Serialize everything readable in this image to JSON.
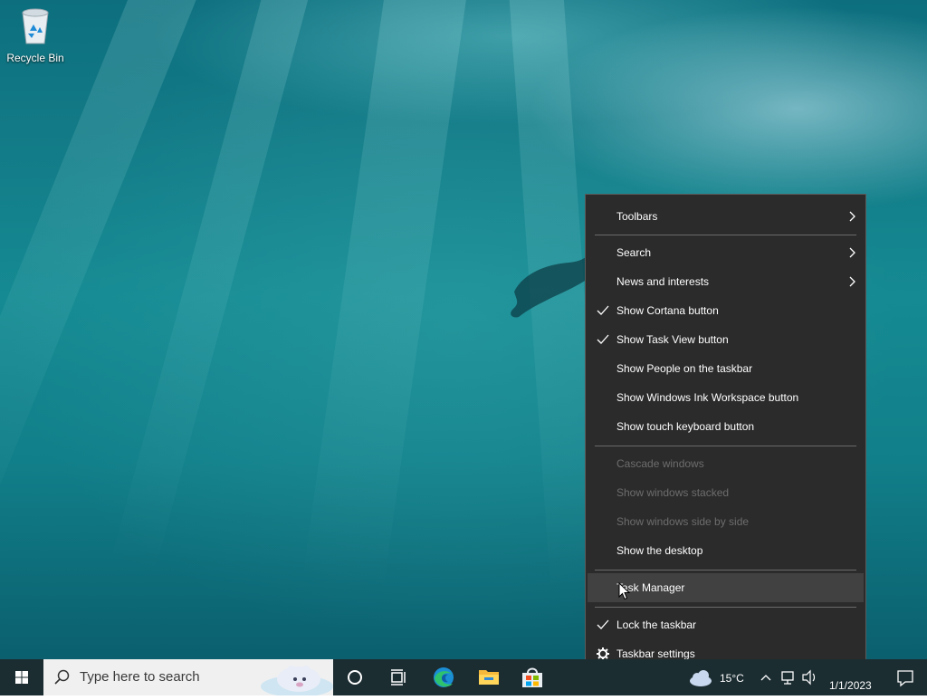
{
  "desktop": {
    "icons": [
      {
        "label": "Recycle Bin",
        "icon": "recycle-bin-icon"
      }
    ]
  },
  "context_menu": {
    "items": [
      {
        "label": "Toolbars",
        "submenu": true
      },
      {
        "label": "Search",
        "submenu": true
      },
      {
        "label": "News and interests",
        "submenu": true
      },
      {
        "label": "Show Cortana button",
        "checked": true
      },
      {
        "label": "Show Task View button",
        "checked": true
      },
      {
        "label": "Show People on the taskbar"
      },
      {
        "label": "Show Windows Ink Workspace button"
      },
      {
        "label": "Show touch keyboard button"
      },
      {
        "label": "Cascade windows",
        "disabled": true
      },
      {
        "label": "Show windows stacked",
        "disabled": true
      },
      {
        "label": "Show windows side by side",
        "disabled": true
      },
      {
        "label": "Show the desktop"
      },
      {
        "label": "Task Manager",
        "hovered": true
      },
      {
        "label": "Lock the taskbar",
        "checked": true
      },
      {
        "label": "Taskbar settings",
        "icon": "gear-icon"
      }
    ]
  },
  "taskbar": {
    "start_icon": "windows-logo-icon",
    "search_placeholder": "Type here to search",
    "search_icon": "search-icon",
    "pinned": [
      "cortana-icon",
      "task-view-icon",
      "edge-icon",
      "file-explorer-icon",
      "store-icon"
    ],
    "tray": {
      "weather_icon": "weather-cloud-icon",
      "temperature": "15°C",
      "date": "1/1/2023",
      "notification_icon": "action-center-icon"
    }
  },
  "colors": {
    "menu_bg": "#2b2b2b",
    "menu_hover": "#414141",
    "taskbar_bg": "#1c2d32",
    "search_bg": "#f0f0f0",
    "disabled_text": "#6d6d6d"
  }
}
